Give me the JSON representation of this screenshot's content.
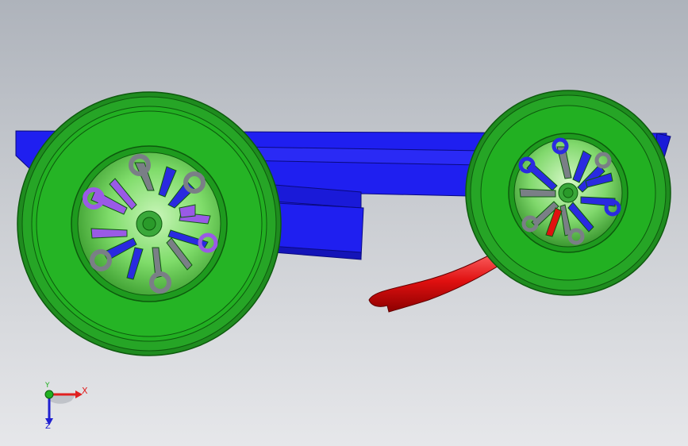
{
  "viewport": {
    "background_top": "#aeb3bb",
    "background_bottom": "#e6e7ea"
  },
  "model": {
    "chassis_color": "#1f1ff0",
    "tire_color": "#22b022",
    "hub_face_color": "#7fdc6a",
    "spoke_blue_color": "#2a2ae0",
    "spoke_purple_color": "#9a5ae6",
    "spoke_gray_color": "#7a7f86",
    "steering_arm_color": "#e01010"
  },
  "triad": {
    "x_label": "X",
    "y_label": "Y",
    "z_label": "Z",
    "x_color": "#e02020",
    "y_color": "#20b020",
    "z_color": "#2020d0"
  }
}
